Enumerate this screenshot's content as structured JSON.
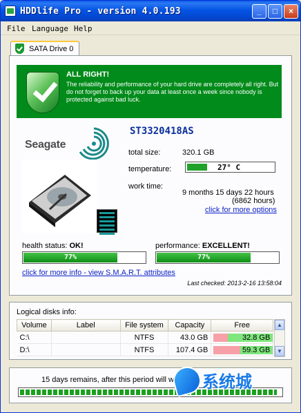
{
  "window": {
    "title": "HDDlife Pro - version 4.0.193",
    "min": "_",
    "max": "□",
    "close": "×"
  },
  "menu": [
    {
      "label": "File"
    },
    {
      "label": "Language"
    },
    {
      "label": "Help"
    }
  ],
  "tab": {
    "label": "SATA Drive 0"
  },
  "status": {
    "title": "ALL RIGHT!",
    "text": "The reliability and performance of your hard drive are completely all right. But do not forget to back up your data at least once a week since nobody is protected against bad luck."
  },
  "drive": {
    "brand": "Seagate",
    "model": "ST3320418AS",
    "total_size_label": "total size:",
    "total_size": "320.1 GB",
    "temperature_label": "temperature:",
    "temperature": "27° C",
    "temperature_level": 0.23,
    "work_time_label": "work time:",
    "work_time": "9 months 15 days 22 hours",
    "work_hours": "(6862 hours)",
    "more_options_link": "click for more options"
  },
  "health": {
    "label": "health status:",
    "value": "OK!",
    "percent": "77%",
    "level": 0.77
  },
  "performance": {
    "label": "performance:",
    "value": "EXCELLENT!",
    "percent": "77%",
    "level": 0.77
  },
  "smart_link": "click for more info - view S.M.A.R.T.  attributes",
  "last_checked": "Last checked: 2013-2-16 13:58:04",
  "logical_disks": {
    "title": "Logical disks info:",
    "columns": [
      "Volume",
      "Label",
      "File system",
      "Capacity",
      "Free"
    ],
    "rows": [
      {
        "volume": "C:\\",
        "label": "",
        "fs": "NTFS",
        "capacity": "43.0 GB",
        "free": "32.8 GB",
        "free_ratio": 0.76
      },
      {
        "volume": "D:\\",
        "label": "",
        "fs": "NTFS",
        "capacity": "107.4 GB",
        "free": "59.3 GB",
        "free_ratio": 0.55
      }
    ]
  },
  "license": {
    "text": "15 days remains, after this period will wo",
    "level": 0.98
  },
  "watermark": {
    "text": "系统城"
  },
  "colors": {
    "banner": "#008b1a",
    "bar_green": "#1ba01f",
    "free_low": "#f7a0a8",
    "free_high": "#7ee67d",
    "link": "#0a1fc4"
  }
}
